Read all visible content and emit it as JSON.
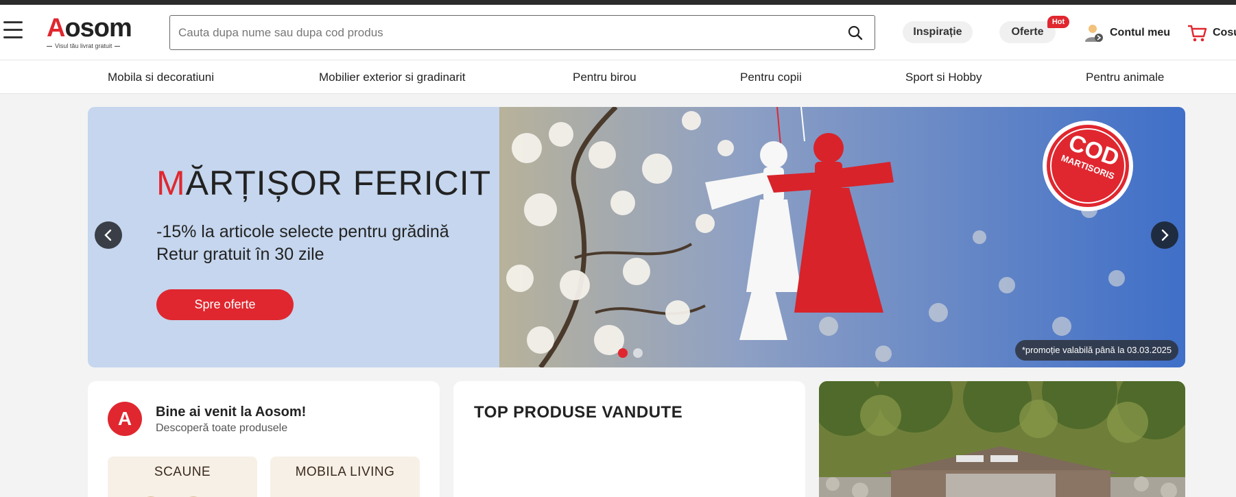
{
  "header": {
    "logo_text": "Aosom",
    "logo_tagline": "Visul tău livrat gratuit",
    "search_placeholder": "Cauta dupa nume sau dupa cod produs",
    "inspiration_label": "Inspirație",
    "offers_label": "Oferte",
    "hot_badge": "Hot",
    "account_label": "Contul meu",
    "cart_label": "Cosul"
  },
  "nav": {
    "items": [
      {
        "label": "Mobila si decoratiuni"
      },
      {
        "label": "Mobilier exterior si gradinarit"
      },
      {
        "label": "Pentru birou"
      },
      {
        "label": "Pentru copii"
      },
      {
        "label": "Sport si Hobby"
      },
      {
        "label": "Pentru animale"
      }
    ]
  },
  "hero": {
    "title_first": "M",
    "title_rest": "ĂRȚIȘOR FERICIT",
    "subtitle_1": "-15% la articole selecte pentru grădină",
    "subtitle_2": "Retur gratuit în 30 zile",
    "cta_label": "Spre oferte",
    "badge_line1": "COD",
    "badge_line2": "MARTISORIS",
    "promo_note": "*promoție valabilă până la 03.03.2025",
    "slide_count": 2,
    "active_slide": 1
  },
  "welcome": {
    "avatar_letter": "A",
    "title": "Bine ai venit la Aosom!",
    "subtitle": "Descoperă toate produsele",
    "tiles": [
      {
        "label": "SCAUNE"
      },
      {
        "label": "MOBILA LIVING"
      }
    ]
  },
  "top_products": {
    "title": "TOP PRODUSE VANDUTE"
  },
  "colors": {
    "brand_red": "#e0272f",
    "hero_bg": "#c5d6ee",
    "dark_text": "#222222"
  }
}
